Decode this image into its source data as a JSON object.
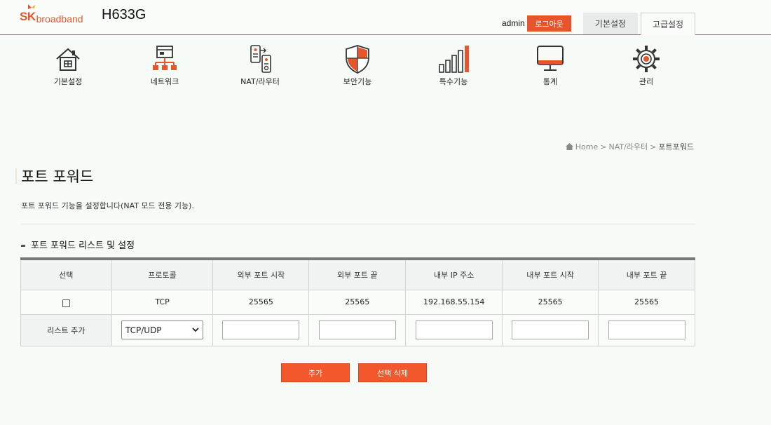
{
  "header": {
    "logo_sk": "SK",
    "logo_broadband": "broadband",
    "model": "H633G",
    "user": "admin",
    "logout_label": "로그아웃",
    "tabs": [
      {
        "label": "기본설정"
      },
      {
        "label": "고급설정"
      }
    ],
    "accent_color": "#e8552d"
  },
  "nav": [
    {
      "label": "기본설정",
      "icon": "house-icon"
    },
    {
      "label": "네트워크",
      "icon": "network-icon"
    },
    {
      "label": "NAT/라우터",
      "icon": "router-icon"
    },
    {
      "label": "보안기능",
      "icon": "shield-icon"
    },
    {
      "label": "특수기능",
      "icon": "signal-bars-icon"
    },
    {
      "label": "통계",
      "icon": "monitor-icon"
    },
    {
      "label": "관리",
      "icon": "gear-icon"
    }
  ],
  "breadcrumb": {
    "home": "Home",
    "sep": ">",
    "level1": "NAT/라우터",
    "current": "포트포워드"
  },
  "page": {
    "title": "포트 포워드",
    "description": "포트 포워드 기능을 설정합니다(NAT 모드 전용 기능).",
    "section_title": "포트 포워드 리스트 및 설정"
  },
  "table": {
    "columns": [
      "선택",
      "프로토콜",
      "외부 포트 시작",
      "외부 포트 끝",
      "내부 IP 주소",
      "내부 포트 시작",
      "내부 포트 끝"
    ],
    "rows": [
      {
        "checked": false,
        "protocol": "TCP",
        "ext_start": "25565",
        "ext_end": "25565",
        "int_ip": "192.168.55.154",
        "int_start": "25565",
        "int_end": "25565"
      }
    ],
    "add_row": {
      "label": "리스트 추가",
      "protocol_selected": "TCP/UDP",
      "ext_start": "",
      "ext_end": "",
      "int_ip": "",
      "int_start": "",
      "int_end": ""
    }
  },
  "buttons": {
    "add": "추가",
    "delete_selected": "선택 삭제"
  }
}
